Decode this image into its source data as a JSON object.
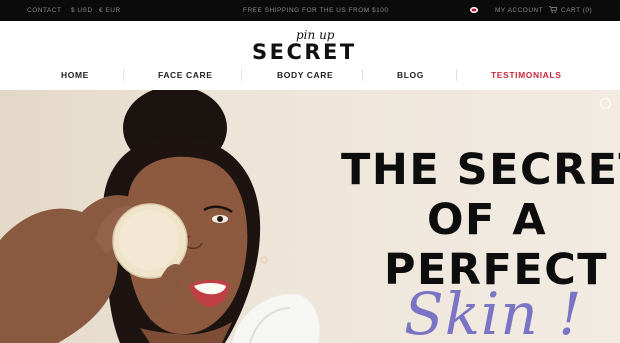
{
  "topbar": {
    "contact": "CONTACT",
    "currency_usd": "$ USD",
    "currency_eur": "€ EUR",
    "shipping_notice": "FREE SHIPPING FOR THE US FROM $100",
    "account": "MY ACCOUNT",
    "cart": "CART (0)"
  },
  "logo": {
    "script": "pin up",
    "main": "SECRET"
  },
  "nav": [
    {
      "label": "HOME"
    },
    {
      "label": "FACE CARE"
    },
    {
      "label": "BODY CARE"
    },
    {
      "label": "BLOG"
    },
    {
      "label": "TESTIMONIALS",
      "active": true
    }
  ],
  "hero": {
    "line1": "THE SECRET",
    "line2": "OF A",
    "line3": "PERFECT",
    "script": "Skin !"
  },
  "colors": {
    "accent": "#c5283d",
    "script": "#7a74c4",
    "topbar_bg": "#0b0b0b"
  },
  "icons": {
    "flag": "us-flag-icon",
    "cart": "cart-icon",
    "slider": "slider-dot-icon"
  }
}
